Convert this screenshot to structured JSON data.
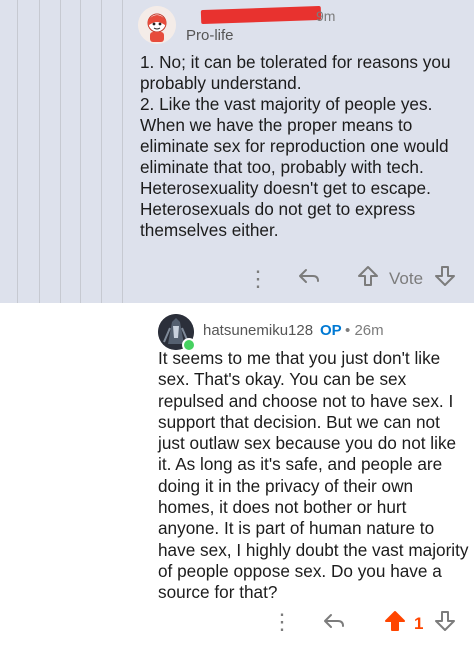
{
  "parent_comment": {
    "username_suffix": "9m",
    "flair": "Pro-life",
    "body": [
      "1. No; it can be tolerated for reasons you probably understand.",
      "2. Like the vast majority of people yes. When we have the proper means to eliminate sex for reproduction one would eliminate that too, probably with tech. Heterosexuality doesn't get to escape. Heterosexuals do not get to express themselves either."
    ],
    "actions": {
      "more": "more-options-icon",
      "reply": "reply-icon",
      "upvote": "upvote-arrow-icon",
      "vote_label": "Vote",
      "downvote": "downvote-arrow-icon"
    }
  },
  "reply_comment": {
    "username": "hatsunemiku128",
    "op_badge": "OP",
    "separator": "•",
    "time": "26m",
    "body": "It seems to me that you just don't like sex. That's okay. You can be sex repulsed and choose not to have sex. I support that decision. But we can not just outlaw sex because you do not like it. As long as it's safe, and people are doing it in the privacy of their own homes, it does not bother or hurt anyone. It is part of human nature to have sex, I highly doubt the vast majority of people oppose sex. Do you have a source for that?",
    "actions": {
      "more": "more-options-icon",
      "reply": "reply-icon",
      "upvote": "upvote-arrow-icon",
      "vote_count": "1",
      "downvote": "downvote-arrow-icon"
    }
  },
  "colors": {
    "parent_bg": "#dde1ec",
    "upvote_active": "#ff4500",
    "op": "#0079d3",
    "online": "#46d160"
  }
}
